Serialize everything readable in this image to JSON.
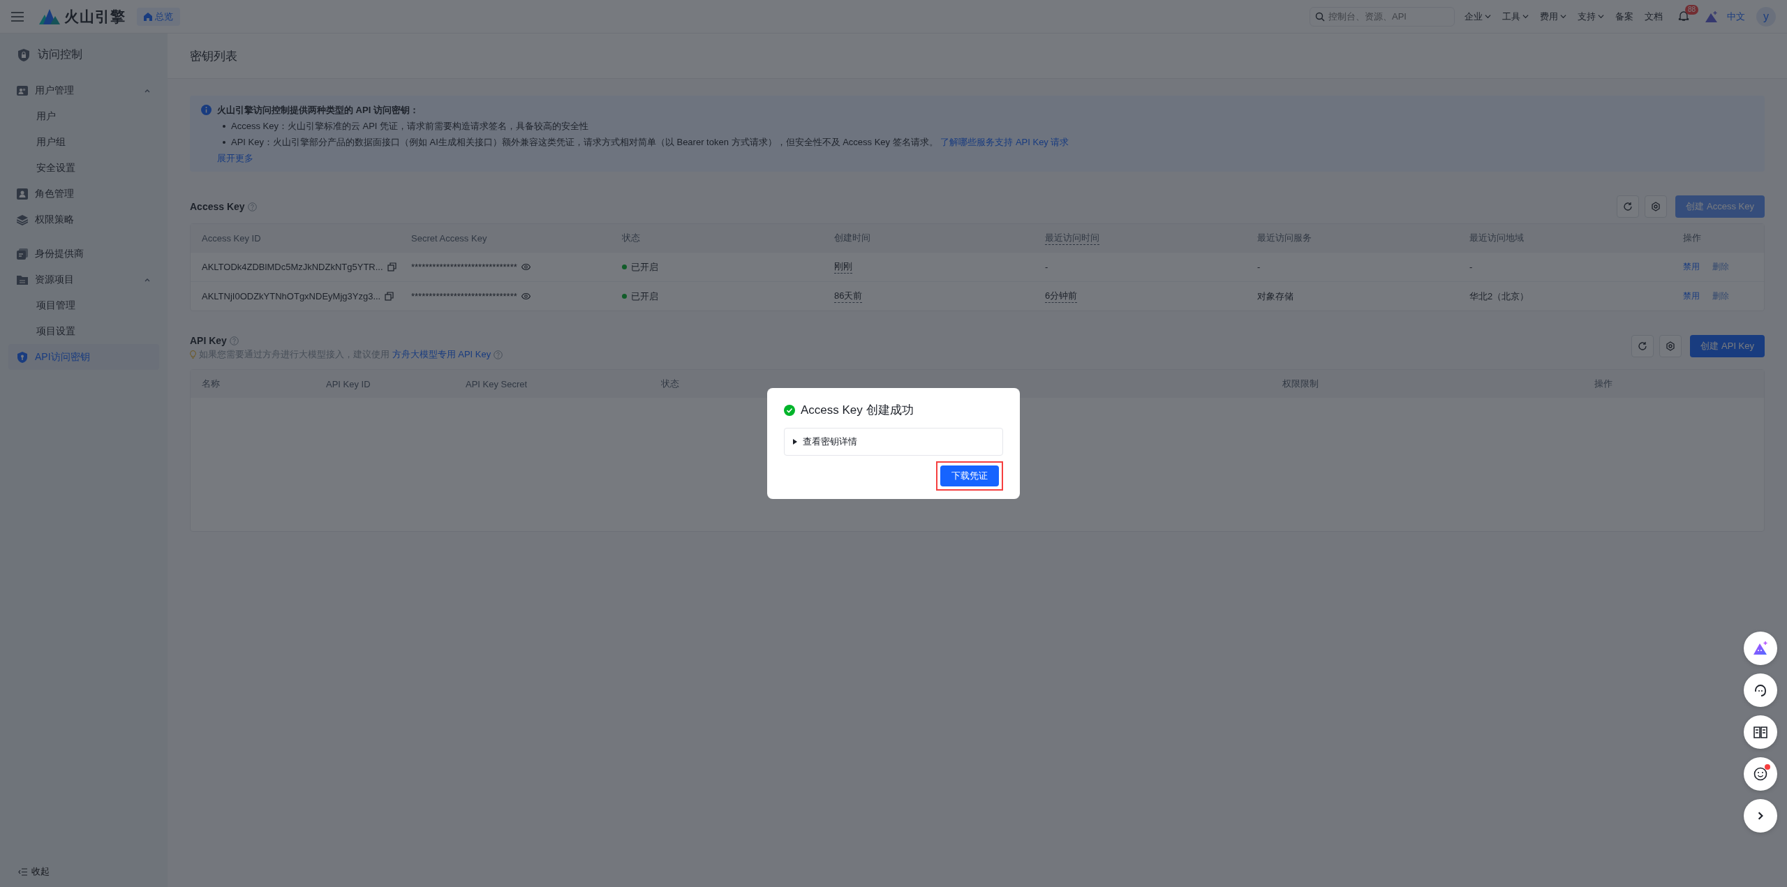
{
  "topbar": {
    "logo_text": "火山引擎",
    "home_button": "总览",
    "search": {
      "placeholder": "控制台、资源、API"
    },
    "menus": [
      {
        "label": "企业",
        "dropdown": true
      },
      {
        "label": "工具",
        "dropdown": true
      },
      {
        "label": "费用",
        "dropdown": true
      },
      {
        "label": "支持",
        "dropdown": true
      },
      {
        "label": "备案",
        "dropdown": false
      },
      {
        "label": "文档",
        "dropdown": false
      }
    ],
    "notification_badge": "88",
    "language": "中文",
    "avatar": "y"
  },
  "sidebar": {
    "title": "访问控制",
    "groups": [
      [
        {
          "label": "用户管理",
          "kind": "users",
          "expanded": true,
          "selected": false,
          "children": [
            {
              "label": "用户",
              "selected": false
            },
            {
              "label": "用户组",
              "selected": false
            },
            {
              "label": "安全设置",
              "selected": false
            }
          ]
        },
        {
          "label": "角色管理",
          "kind": "person",
          "selected": false
        },
        {
          "label": "权限策略",
          "kind": "layers",
          "selected": false
        }
      ],
      [
        {
          "label": "身份提供商",
          "kind": "card",
          "selected": false
        },
        {
          "label": "资源项目",
          "kind": "folder",
          "expanded": true,
          "selected": false,
          "children": [
            {
              "label": "项目管理",
              "selected": false
            },
            {
              "label": "项目设置",
              "selected": false
            }
          ]
        },
        {
          "label": "API访问密钥",
          "kind": "key",
          "selected": true
        }
      ]
    ],
    "collapse": "收起"
  },
  "page_title": "密钥列表",
  "notice": {
    "title": "火山引擎访问控制提供两种类型的 API 访问密钥：",
    "bullets": [
      {
        "text": "Access Key：火山引擎标准的云 API 凭证，请求前需要构造请求签名，具备较高的安全性"
      },
      {
        "text": "API Key：火山引擎部分产品的数据面接口（例如 AI生成相关接口）额外兼容这类凭证，请求方式相对简单（以 Bearer token 方式请求），但安全性不及 Access Key 签名请求。",
        "link": "了解哪些服务支持 API Key 请求"
      }
    ],
    "more": "展开更多"
  },
  "access_key": {
    "title": "Access Key",
    "create_button": {
      "label": "创建 Access Key",
      "disabled": true
    },
    "columns": [
      {
        "label": "Access Key ID",
        "dotted": false
      },
      {
        "label": "Secret Access Key",
        "dotted": false
      },
      {
        "label": "状态",
        "dotted": false
      },
      {
        "label": "创建时间",
        "dotted": false
      },
      {
        "label": "最近访问时间",
        "dotted": true
      },
      {
        "label": "最近访问服务",
        "dotted": false
      },
      {
        "label": "最近访问地域",
        "dotted": false
      },
      {
        "label": "操作",
        "dotted": false
      }
    ],
    "rows": [
      {
        "id": "AKLTODk4ZDBlMDc5MzJkNDZkNTg5YTR...",
        "secret": "******************************",
        "status": {
          "text": "已开启",
          "on": true
        },
        "created": {
          "text": "刚刚",
          "dotted": true
        },
        "last_access": {
          "text": "-",
          "dotted": false
        },
        "service": "-",
        "region": "-",
        "actions": [
          {
            "label": "禁用",
            "disabled": false
          },
          {
            "label": "删除",
            "disabled": true
          }
        ]
      },
      {
        "id": "AKLTNjI0ODZkYTNhOTgxNDEyMjg3Yzg3...",
        "secret": "******************************",
        "status": {
          "text": "已开启",
          "on": true
        },
        "created": {
          "text": "86天前",
          "dotted": true
        },
        "last_access": {
          "text": "6分钟前",
          "dotted": true
        },
        "service": "对象存储",
        "region": "华北2（北京）",
        "actions": [
          {
            "label": "禁用",
            "disabled": false
          },
          {
            "label": "删除",
            "disabled": true
          }
        ]
      }
    ]
  },
  "api_key": {
    "title": "API Key",
    "hint": "如果您需要通过方舟进行大模型接入，建议使用",
    "hint_link": "方舟大模型专用 API Key",
    "create_button": {
      "label": "创建 API Key",
      "disabled": false
    },
    "columns": [
      "名称",
      "API Key ID",
      "API Key Secret",
      "状态",
      "权限限制",
      "操作"
    ]
  },
  "dialog": {
    "title": "Access Key 创建成功",
    "details": {
      "label": "查看密钥详情",
      "expanded": false
    },
    "button": {
      "label": "下载凭证",
      "highlighted": true
    }
  },
  "float_buttons": [
    {
      "kind": "assistant",
      "dot": false
    },
    {
      "kind": "support",
      "dot": false
    },
    {
      "kind": "docs",
      "dot": false
    },
    {
      "kind": "feedback",
      "dot": true
    },
    {
      "kind": "expand",
      "dot": false
    }
  ]
}
